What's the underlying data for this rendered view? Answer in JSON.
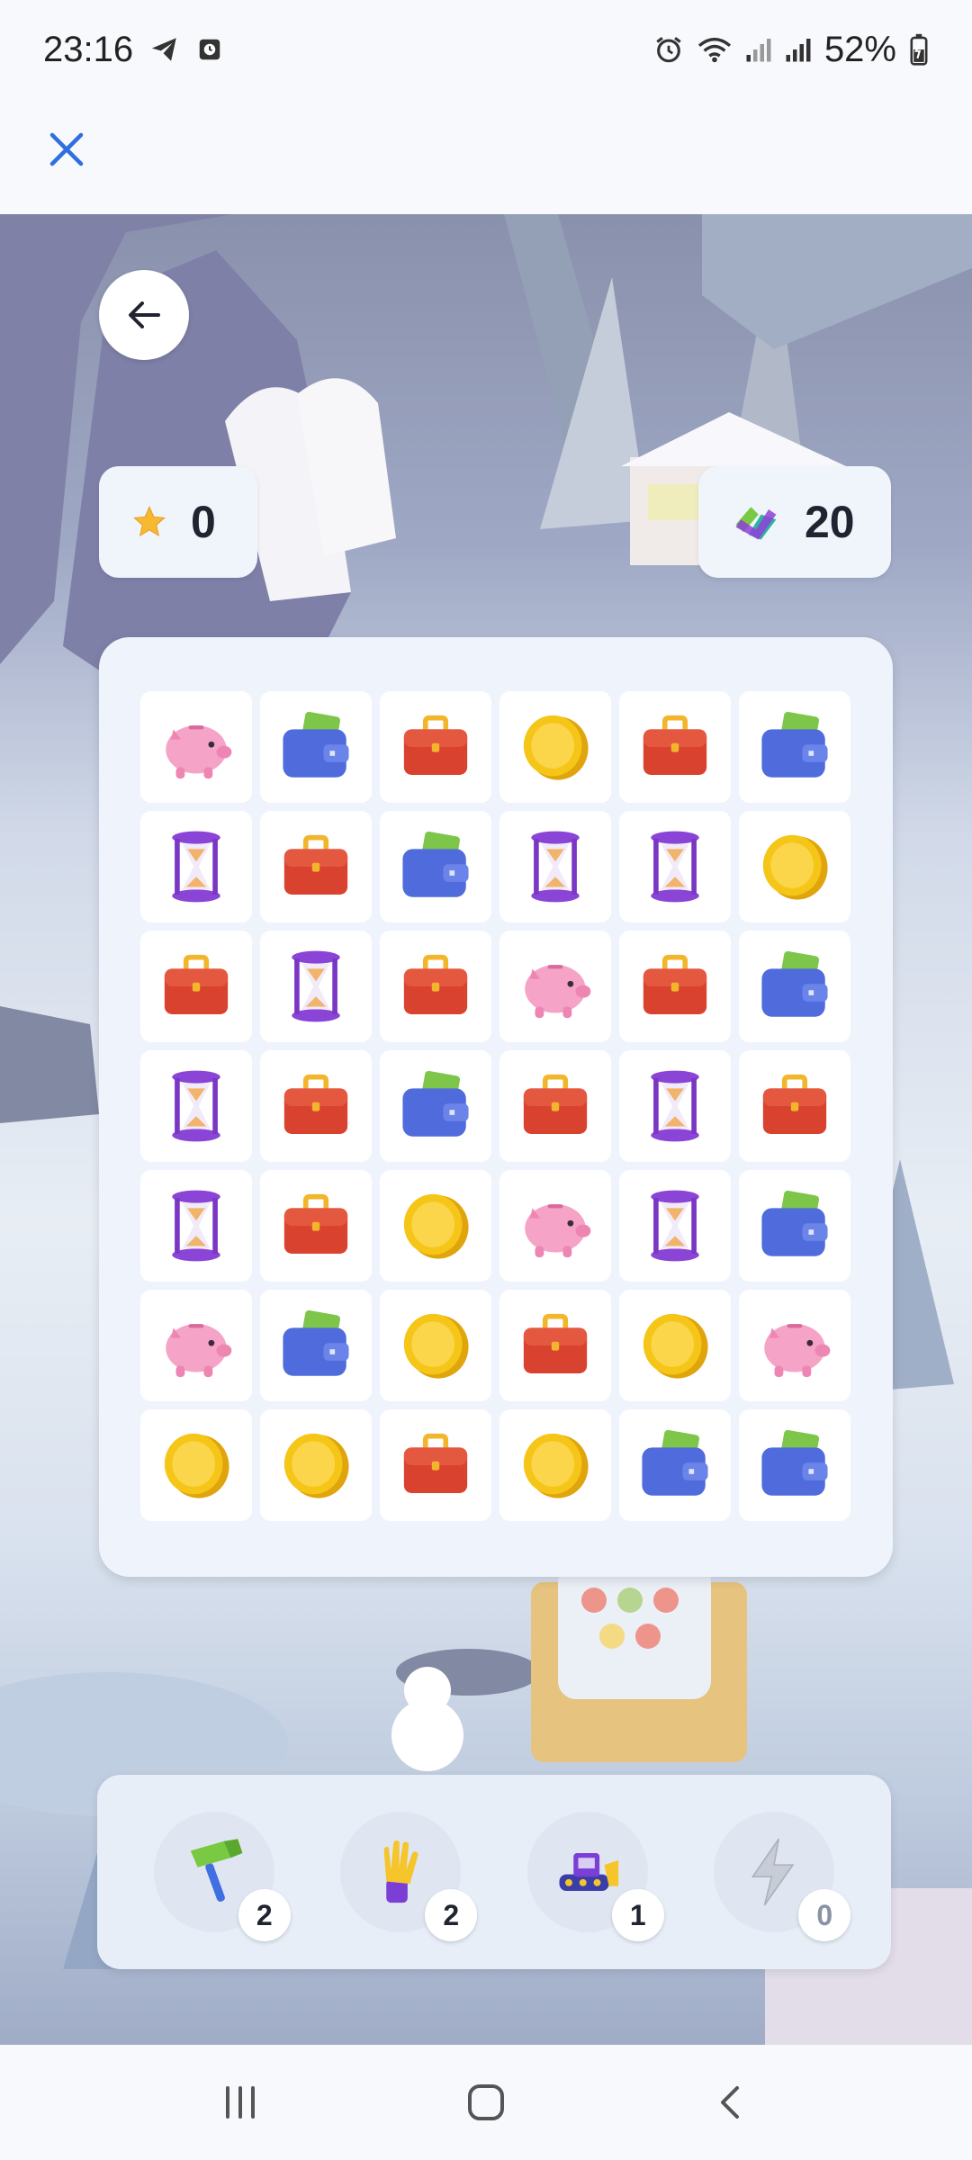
{
  "status_bar": {
    "time": "23:16",
    "battery": "52%",
    "icons_left": [
      "telegram-icon",
      "screen-record-icon"
    ],
    "icons_right": [
      "alarm-icon",
      "wifi-icon",
      "signal-icon",
      "signal-icon",
      "battery-charging-icon"
    ]
  },
  "top_bar": {
    "close_icon": "close-icon"
  },
  "game": {
    "back_icon": "arrow-left-icon",
    "score": {
      "icon": "star-icon",
      "value": "0"
    },
    "moves": {
      "icon": "moves-icon",
      "value": "20"
    },
    "board": {
      "columns": 6,
      "rows": [
        [
          "piggy",
          "wallet",
          "briefcase",
          "coin",
          "briefcase",
          "wallet"
        ],
        [
          "hourglass",
          "briefcase",
          "wallet",
          "hourglass",
          "hourglass",
          "coin"
        ],
        [
          "briefcase",
          "hourglass",
          "briefcase",
          "piggy",
          "briefcase",
          "wallet"
        ],
        [
          "hourglass",
          "briefcase",
          "wallet",
          "briefcase",
          "hourglass",
          "briefcase"
        ],
        [
          "hourglass",
          "briefcase",
          "coin",
          "piggy",
          "hourglass",
          "wallet"
        ],
        [
          "piggy",
          "wallet",
          "coin",
          "briefcase",
          "coin",
          "piggy"
        ],
        [
          "coin",
          "coin",
          "briefcase",
          "coin",
          "wallet",
          "wallet"
        ]
      ]
    },
    "boosters": [
      {
        "name": "hammer",
        "icon": "hammer-icon",
        "count": "2"
      },
      {
        "name": "glove",
        "icon": "glove-icon",
        "count": "2"
      },
      {
        "name": "bulldozer",
        "icon": "bulldozer-icon",
        "count": "1"
      },
      {
        "name": "lightning",
        "icon": "lightning-icon",
        "count": "0"
      }
    ]
  },
  "nav_bar": {
    "icons": [
      "recent-apps-icon",
      "home-icon",
      "back-nav-icon"
    ]
  },
  "colors": {
    "accent_close": "#2f6fe0",
    "coin": "#f5c518",
    "briefcase": "#d8422e",
    "wallet": "#4f6bdc",
    "wallet_card": "#7dc64a",
    "piggy": "#f5a3c7",
    "hourglass": "#8b45d6",
    "star": "#f8b932"
  }
}
